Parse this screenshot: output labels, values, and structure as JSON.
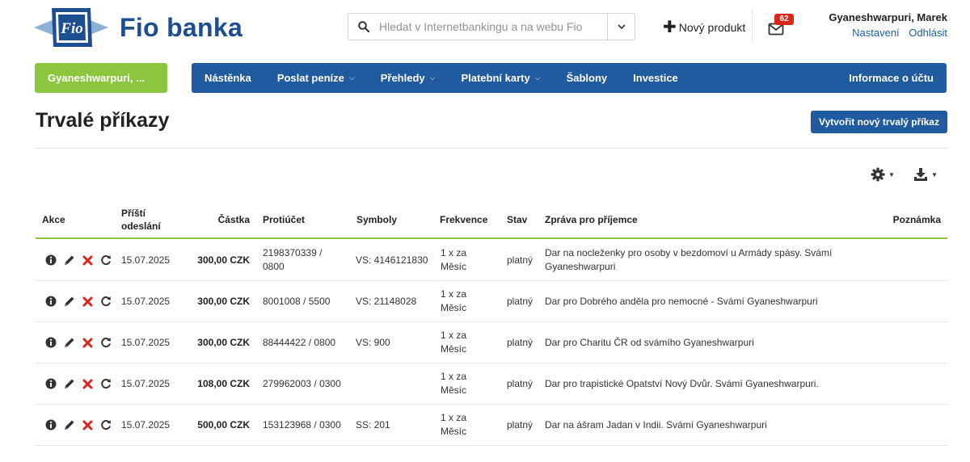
{
  "brand": {
    "name": "Fio banka",
    "logo_word": "Fio",
    "color": "#1d4e8f",
    "accent": "#8cc63f"
  },
  "header": {
    "search": {
      "placeholder": "Hledat v Internetbankingu a na webu Fio",
      "icon": "search-icon",
      "dropdown_icon": "chevron-down-icon"
    },
    "new_product": {
      "label": "Nový produkt",
      "icon": "plus-icon"
    },
    "messages": {
      "icon": "envelope-icon",
      "count": "62"
    },
    "user": {
      "name": "Gyaneshwarpuri, Marek",
      "settings": "Nastavení",
      "logout": "Odhlásit"
    }
  },
  "nav": {
    "account_label": "Gyaneshwarpuri, ...",
    "items": [
      {
        "label": "Nástěnka",
        "dropdown": false
      },
      {
        "label": "Poslat peníze",
        "dropdown": true
      },
      {
        "label": "Přehledy",
        "dropdown": true
      },
      {
        "label": "Platební karty",
        "dropdown": true
      },
      {
        "label": "Šablony",
        "dropdown": false
      },
      {
        "label": "Investice",
        "dropdown": false
      }
    ],
    "right_item": "Informace o účtu"
  },
  "page": {
    "title": "Trvalé příkazy",
    "create_button": "Vytvořit nový trvalý příkaz",
    "settings_icon": "gear-icon",
    "export_icon": "download-icon"
  },
  "table": {
    "headers": {
      "actions": "Akce",
      "next_send": "Příští\nodeslání",
      "amount": "Částka",
      "counter_account": "Protiúčet",
      "symbols": "Symboly",
      "frequency": "Frekvence",
      "status": "Stav",
      "message": "Zpráva pro příjemce",
      "note": "Poznámka"
    },
    "rows": [
      {
        "date": "15.07.2025",
        "amount": "300,00 CZK",
        "account": "2198370339 / 0800",
        "symbols": "VS: 4146121830",
        "frequency": "1 x za Měsíc",
        "status": "platný",
        "message": "Dar na nocleženky pro osoby v bezdomoví u Armády spásy. Svámí Gyaneshwarpuri",
        "note": ""
      },
      {
        "date": "15.07.2025",
        "amount": "300,00 CZK",
        "account": "8001008 / 5500",
        "symbols": "VS: 21148028",
        "frequency": "1 x za Měsíc",
        "status": "platný",
        "message": "Dar pro Dobrého anděla pro nemocné - Svámí Gyaneshwarpuri",
        "note": ""
      },
      {
        "date": "15.07.2025",
        "amount": "300,00 CZK",
        "account": "88444422 / 0800",
        "symbols": "VS: 900",
        "frequency": "1 x za Měsíc",
        "status": "platný",
        "message": "Dar pro Charitu ČR od svámího Gyaneshwarpuri",
        "note": ""
      },
      {
        "date": "15.07.2025",
        "amount": "108,00 CZK",
        "account": "279962003 / 0300",
        "symbols": "",
        "frequency": "1 x za Měsíc",
        "status": "platný",
        "message": "Dar pro trapistické Opatství Nový Dvůr. Svámí Gyaneshwarpuri.",
        "note": ""
      },
      {
        "date": "15.07.2025",
        "amount": "500,00 CZK",
        "account": "153123968 / 0300",
        "symbols": "SS: 201",
        "frequency": "1 x za Měsíc",
        "status": "platný",
        "message": "Dar na ášram Jadan v Indii. Svámí Gyaneshwarpuri",
        "note": ""
      }
    ],
    "row_action_icons": [
      "info-icon",
      "edit-icon",
      "delete-icon",
      "refresh-icon"
    ]
  }
}
